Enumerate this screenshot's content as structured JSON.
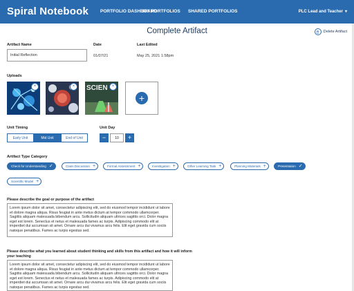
{
  "header": {
    "brand": "Spiral Notebook",
    "nav": [
      "PORTFOLIO DASHBOARD",
      "MY PORTFOLIOS",
      "SHARED PORTFOLIOS"
    ],
    "user": "PLC Lead and Teacher"
  },
  "page": {
    "title": "Complete Artifact",
    "delete_label": "Delete Artifact"
  },
  "artifact": {
    "name_label": "Artifact Name",
    "name_value": "Initial Reflection",
    "date_label": "Date",
    "date_value": "01/07/21",
    "edited_label": "Last Edited",
    "edited_value": "May 25, 2021 1:58pm"
  },
  "uploads": {
    "label": "Uploads",
    "thumb3_text": "SCIEN"
  },
  "unit_timing": {
    "label": "Unit Timing",
    "options": [
      "Early Unit",
      "Mid Unit",
      "End of Unit"
    ],
    "selected": "Mid Unit"
  },
  "unit_day": {
    "label": "Unit Day",
    "value": "10"
  },
  "category": {
    "label": "Artifact Type Category",
    "chips": [
      {
        "label": "Check for Understanding",
        "active": true
      },
      {
        "label": "Class Discussion",
        "active": false
      },
      {
        "label": "Formal Assessment",
        "active": false
      },
      {
        "label": "Investigation",
        "active": false
      },
      {
        "label": "Other Learning Task",
        "active": false
      },
      {
        "label": "Planning Materials",
        "active": false
      },
      {
        "label": "Presentation",
        "active": true
      },
      {
        "label": "Scientific Model",
        "active": false
      }
    ]
  },
  "q1": {
    "label": "Please describe the goal or purpose of the artifact",
    "text": "Lorem ipsum dolor sit amet, consectetur adipiscing elit, sed do eiusmod tempor incididunt ut labore et dolore magna aliqua. Risus feugiat in ante metus dictum at tempor commodo ullamcorper. Sagittis aliquam malesuada bibendum arcu. Sollicitudin aliquam ultrices sagittis orci. Dolor magna eget est lorem. Senectus et netus et malesuada fames ac turpis. Adipiscing commodo elit at imperdiet dui accumsan sit amet. Ornare arcu dui vivamus arcu felis. Elit eget gravida cum sociis natoque penatibus. Fames ac turpis egestas sed."
  },
  "q2": {
    "label": "Please describe what you learned about student thinking and skills from this artifact and how it will inform your teaching",
    "text": "Lorem ipsum dolor sit amet, consectetur adipiscing elit, sed do eiusmod tempor incididunt ut labore et dolore magna aliqua. Risus feugiat in ante metus dictum at tempor commodo ullamcorper. Sagittis aliquam malesuada bibendum arcu. Sollicitudin aliquam ultrices sagittis orci. Dolor magna eget est lorem. Senectus et netus et malesuada fames ac turpis. Adipiscing commodo elit at imperdiet dui accumsan sit amet. Ornare arcu dui vivamus arcu felis. Elit eget gravida cum sociis natoque penatibus. Fames ac turpis egestas sed."
  },
  "colors": {
    "accent": "#2a6bb0"
  }
}
